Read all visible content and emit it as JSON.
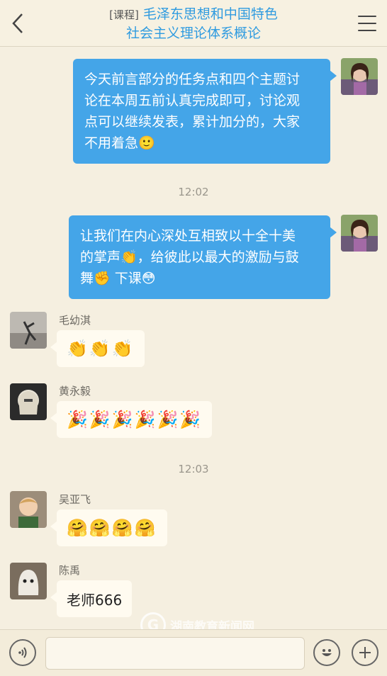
{
  "header": {
    "back_icon": "chevron-left-icon",
    "course_tag": "[课程]",
    "title_line1": "毛泽东思想和中国特色",
    "title_line2": "社会主义理论体系概论",
    "menu_icon": "hamburger-menu-icon"
  },
  "messages": [
    {
      "type": "outgoing",
      "lines": [
        "今天前言部分的任务点和四个主题讨",
        "论在本周五前认真完成即可，讨论观",
        "点可以继续发表，累计加分的，大家",
        "不用着急🙂"
      ]
    },
    {
      "type": "time",
      "text": "12:02"
    },
    {
      "type": "outgoing",
      "lines": [
        "让我们在内心深处互相致以十全十美",
        "的掌声👏，给彼此以最大的激励与鼓",
        "舞✊ 下课😳"
      ]
    },
    {
      "type": "incoming",
      "sender": "毛幼淇",
      "text": "👏👏👏"
    },
    {
      "type": "incoming",
      "sender": "黄永毅",
      "text": "🎉🎉🎉🎉🎉🎉"
    },
    {
      "type": "time",
      "text": "12:03"
    },
    {
      "type": "incoming",
      "sender": "吴亚飞",
      "text": "🤗🤗🤗🤗"
    },
    {
      "type": "incoming",
      "sender": "陈禹",
      "text": "老师666"
    }
  ],
  "watermark": "湖南教育新闻网",
  "input_bar": {
    "voice_icon": "voice-icon",
    "placeholder": "",
    "emoji_icon": "emoji-icon",
    "plus_icon": "plus-icon"
  },
  "colors": {
    "background": "#f5efe0",
    "outgoing_bubble": "#44a5e8",
    "incoming_bubble": "#fffbf0",
    "title_accent": "#2f9be0"
  }
}
